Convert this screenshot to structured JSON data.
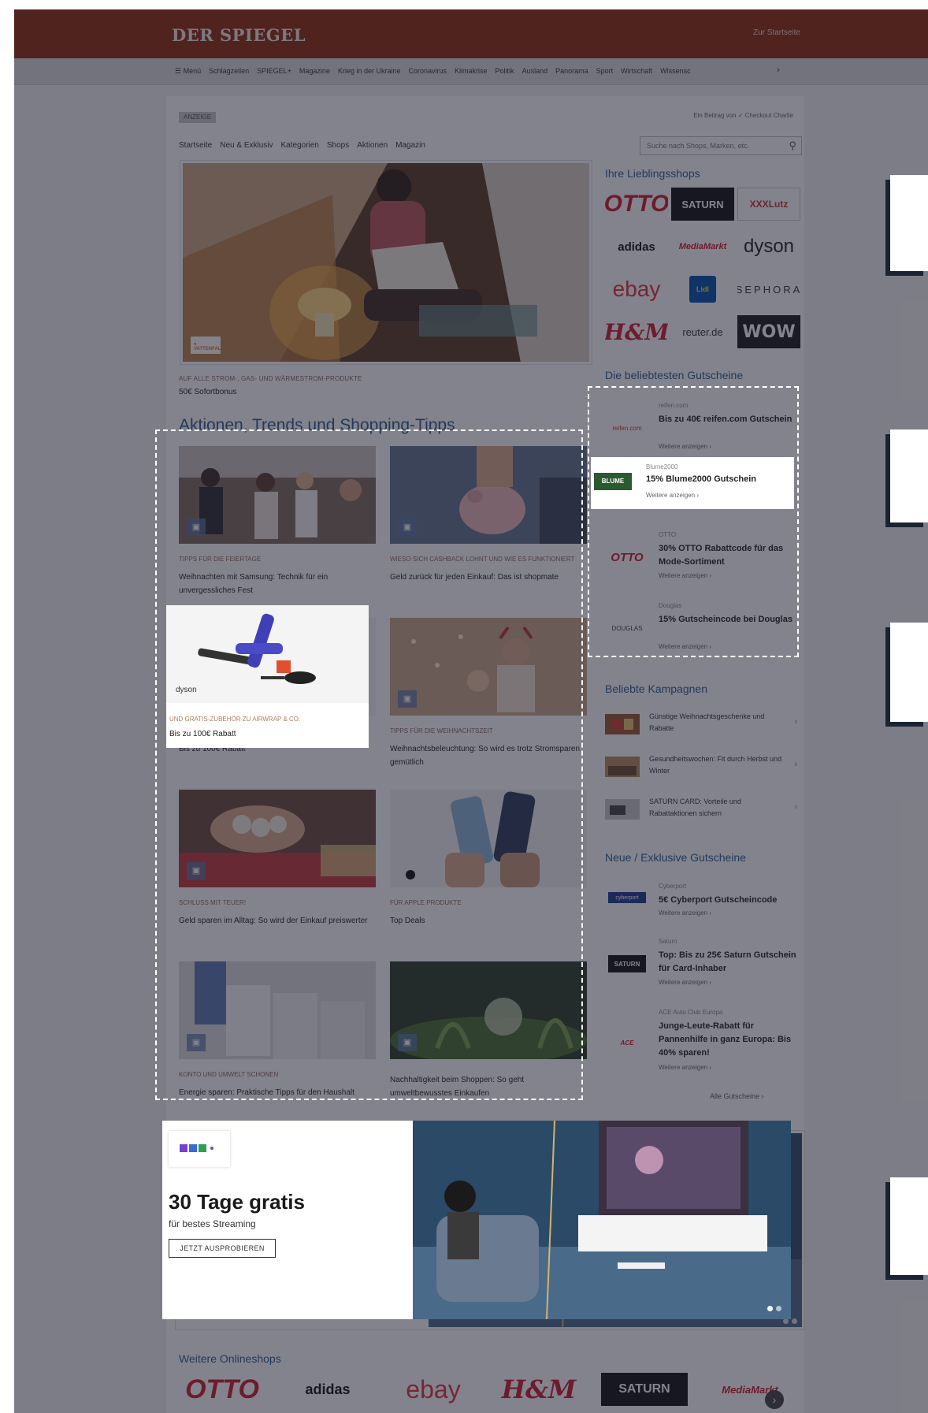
{
  "header": {
    "logo": "DER SPIEGEL",
    "start_link": "Zur Startseite"
  },
  "nav": {
    "menu": "☰  Menü",
    "items": [
      "Schlagzeilen",
      "SPIEGEL+",
      "Magazine",
      "Krieg in der Ukraine",
      "Coronavirus",
      "Klimakrise",
      "Politik",
      "Ausland",
      "Panorama",
      "Sport",
      "Wirtschaft",
      "Wissensc"
    ],
    "more": "›"
  },
  "ad": {
    "label": "ANZEIGE",
    "sponsor": "Ein Beitrag von ✓ Checkout Charlie"
  },
  "subnav": [
    "Startseite",
    "Neu & Exklusiv",
    "Kategorien",
    "Shops",
    "Aktionen",
    "Magazin"
  ],
  "search": {
    "placeholder": "Suche nach Shops, Marken, etc."
  },
  "hero": {
    "badge": "● VATTENFALL",
    "kicker": "AUF ALLE STROM-, GAS- UND WÄRMESTROM-PRODUKTE",
    "title": "50€ Sofortbonus"
  },
  "section_title": "Aktionen, Trends und Shopping-Tipps",
  "cards": [
    {
      "kicker": "TIPPS FÜR DIE FEIERTAGE",
      "title": "Weihnachten mit Samsung: Technik für ein unvergessliches Fest"
    },
    {
      "kicker": "WIESO SICH CASHBACK LOHNT UND WIE ES FUNKTIONIERT",
      "title": "Geld zurück für jeden Einkauf: Das ist shopmate"
    },
    {
      "kicker": "UND GRATIS-ZUBEHÖR ZU AIRWRAP & CO.",
      "title": "Bis zu 100€ Rabatt",
      "brand": "dyson"
    },
    {
      "kicker": "TIPPS FÜR DIE WEIHNACHTSZEIT",
      "title": "Weihnachtsbeleuchtung: So wird es trotz Stromsparen gemütlich"
    },
    {
      "kicker": "SCHLUSS MIT TEUER!",
      "title": "Geld sparen im Alltag: So wird der Einkauf preiswerter"
    },
    {
      "kicker": "FÜR APPLE PRODUKTE",
      "title": "Top Deals"
    },
    {
      "kicker": "KONTO UND UMWELT SCHONEN",
      "title": "Energie sparen: Praktische Tipps für den Haushalt"
    },
    {
      "kicker": "",
      "title": "Nachhaltigkeit beim Shoppen: So geht umweltbewusstes Einkaufen"
    }
  ],
  "favorites": {
    "title": "Ihre Lieblingsshops",
    "shops": [
      "OTTO",
      "SATURN",
      "XXXLutz",
      "adidas",
      "MediaMarkt",
      "dyson",
      "ebay",
      "Lidl",
      "SEPHORA",
      "H&M",
      "reuter.de",
      "WOW"
    ]
  },
  "popular": {
    "title": "Die beliebtesten Gutscheine",
    "items": [
      {
        "logo": "reifen.com",
        "shop": "reifen.com",
        "title": "Bis zu 40€ reifen.com Gutschein",
        "more": "Weitere anzeigen  ›"
      },
      {
        "logo": "BLUME 2000",
        "shop": "Blume2000",
        "title": "15% Blume2000 Gutschein",
        "more": "Weitere anzeigen  ›"
      },
      {
        "logo": "OTTO",
        "shop": "OTTO",
        "title": "30% OTTO Rabattcode für das Mode-Sortiment",
        "more": "Weitere anzeigen  ›"
      },
      {
        "logo": "DOUGLAS",
        "shop": "Douglas",
        "title": "15% Gutscheincode bei Douglas",
        "more": "Weitere anzeigen  ›"
      }
    ]
  },
  "campaigns": {
    "title": "Beliebte Kampagnen",
    "items": [
      {
        "text": "Günstige Weihnachtsgeschenke und Rabatte"
      },
      {
        "text": "Gesundheitswochen: Fit durch Herbst und Winter"
      },
      {
        "text": "SATURN CARD: Vorteile und Rabattaktionen sichern"
      }
    ]
  },
  "new_coupons": {
    "title": "Neue / Exklusive Gutscheine",
    "items": [
      {
        "logo": "cyberport",
        "shop": "Cyberport",
        "title": "5€ Cyberport Gutscheincode",
        "more": "Weitere anzeigen  ›"
      },
      {
        "logo": "SATURN",
        "shop": "Saturn",
        "title": "Top: Bis zu 25€ Saturn Gutschein für Card-Inhaber",
        "more": "Weitere anzeigen  ›"
      },
      {
        "logo": "ACE",
        "shop": "ACE Auto Club Europa",
        "title": "Junge-Leute-Rabatt für Pannenhilfe in ganz Europa: Bis 40% sparen!",
        "more": "Weitere anzeigen  ›"
      }
    ],
    "all": "Alle Gutscheine  ›"
  },
  "rtl": {
    "logo": "RTL+",
    "title": "30 Tage gratis",
    "subtitle": "für bestes Streaming",
    "cta": "JETZT AUSPROBIEREN"
  },
  "more_shops": {
    "title": "Weitere Onlineshops",
    "shops": [
      "OTTO",
      "adidas",
      "ebay",
      "H&M",
      "SATURN",
      "MediaMarkt"
    ]
  },
  "colors": {
    "brand": "#8e2a0c",
    "link_blue": "#2d5c8c",
    "overlay": "#1e1e30"
  }
}
